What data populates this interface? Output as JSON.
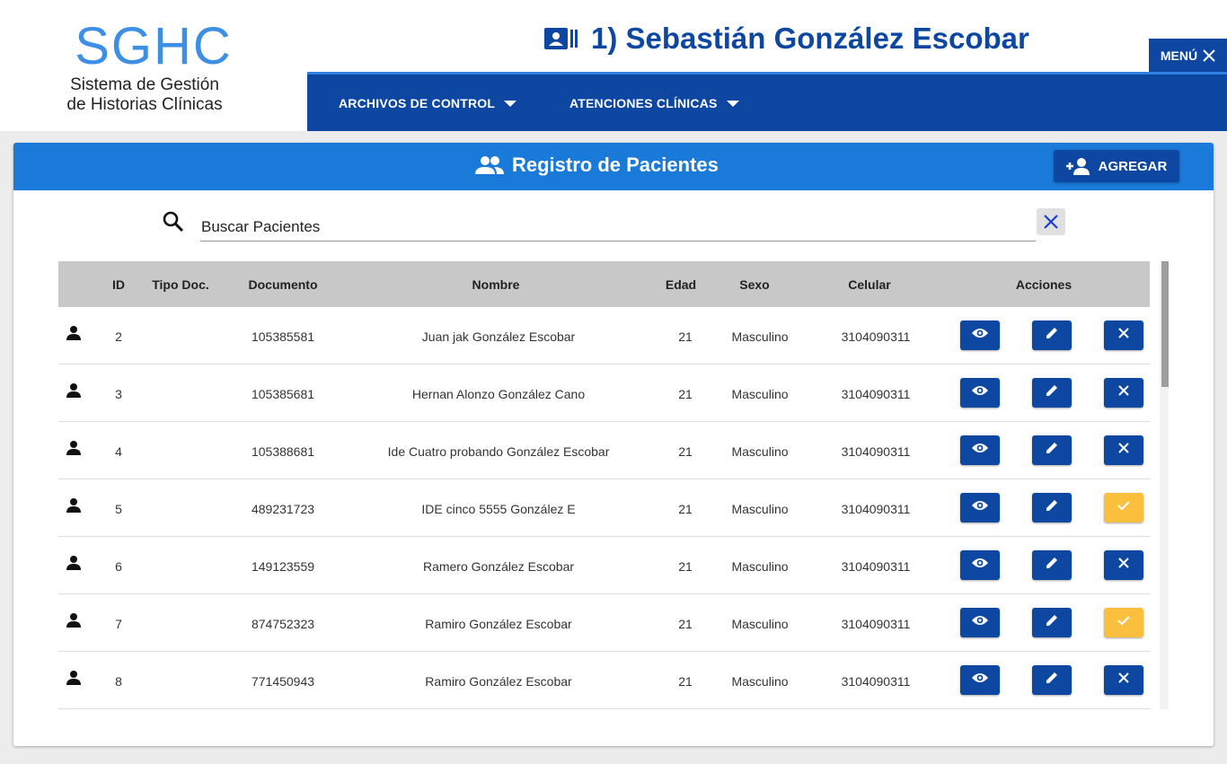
{
  "brand": {
    "title": "SGHC",
    "subtitle_line1": "Sistema de Gestión",
    "subtitle_line2": "de Historias Clínicas"
  },
  "header": {
    "user_label": "1) Sebastián González Escobar",
    "menu_label": "MENÚ"
  },
  "nav": {
    "items": [
      {
        "label": "ARCHIVOS DE CONTROL"
      },
      {
        "label": "ATENCIONES CLÍNICAS"
      }
    ]
  },
  "card": {
    "title": "Registro de Pacientes",
    "add_label": "AGREGAR"
  },
  "search": {
    "placeholder": "Buscar Pacientes",
    "value": ""
  },
  "table": {
    "headers": [
      "ID",
      "Tipo Doc.",
      "Documento",
      "Nombre",
      "Edad",
      "Sexo",
      "Celular",
      "Acciones"
    ],
    "rows": [
      {
        "id": "2",
        "tipo": "",
        "documento": "105385581",
        "nombre": "Juan jak González Escobar",
        "edad": "21",
        "sexo": "Masculino",
        "celular": "3104090311",
        "estado": "activo"
      },
      {
        "id": "3",
        "tipo": "",
        "documento": "105385681",
        "nombre": "Hernan Alonzo González Cano",
        "edad": "21",
        "sexo": "Masculino",
        "celular": "3104090311",
        "estado": "activo"
      },
      {
        "id": "4",
        "tipo": "",
        "documento": "105388681",
        "nombre": "Ide Cuatro probando González Escobar",
        "edad": "21",
        "sexo": "Masculino",
        "celular": "3104090311",
        "estado": "activo"
      },
      {
        "id": "5",
        "tipo": "",
        "documento": "489231723",
        "nombre": "IDE cinco 5555 González E",
        "edad": "21",
        "sexo": "Masculino",
        "celular": "3104090311",
        "estado": "inactivo"
      },
      {
        "id": "6",
        "tipo": "",
        "documento": "149123559",
        "nombre": "Ramero González Escobar",
        "edad": "21",
        "sexo": "Masculino",
        "celular": "3104090311",
        "estado": "activo"
      },
      {
        "id": "7",
        "tipo": "",
        "documento": "874752323",
        "nombre": "Ramiro González Escobar",
        "edad": "21",
        "sexo": "Masculino",
        "celular": "3104090311",
        "estado": "inactivo"
      },
      {
        "id": "8",
        "tipo": "",
        "documento": "771450943",
        "nombre": "Ramiro González Escobar",
        "edad": "21",
        "sexo": "Masculino",
        "celular": "3104090311",
        "estado": "activo"
      }
    ]
  },
  "icons": {
    "row": "person-icon",
    "view": "eye-icon",
    "edit": "pencil-icon",
    "deactivate": "close-icon",
    "activate": "check-icon"
  },
  "colors": {
    "primary": "#0d47a1",
    "header_bar": "#1a7ad9",
    "logo": "#3d8fe6",
    "warning": "#fbbf3e"
  }
}
